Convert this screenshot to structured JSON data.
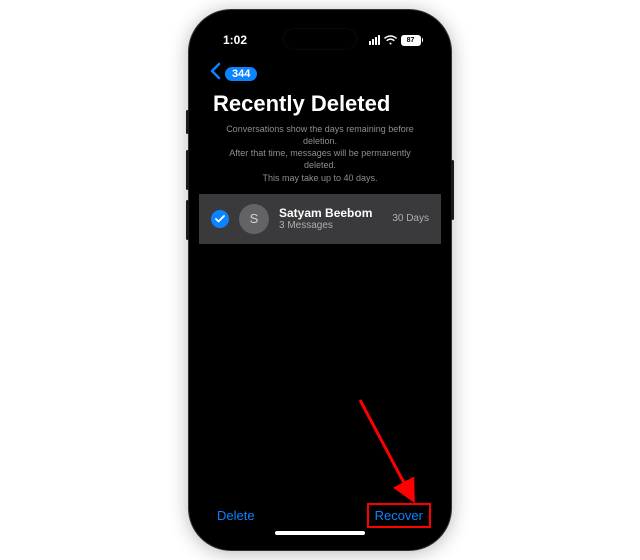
{
  "status": {
    "time": "1:02",
    "battery_percent": "87"
  },
  "nav": {
    "back_count": "344"
  },
  "page": {
    "title": "Recently Deleted",
    "info_line1": "Conversations show the days remaining before deletion.",
    "info_line2": "After that time, messages will be permanently deleted.",
    "info_line3": "This may take up to 40 days."
  },
  "conversations": [
    {
      "avatar_initial": "S",
      "name": "Satyam Beebom",
      "subtitle": "3 Messages",
      "days_remaining": "30 Days",
      "selected": true
    }
  ],
  "toolbar": {
    "delete_label": "Delete",
    "recover_label": "Recover"
  }
}
